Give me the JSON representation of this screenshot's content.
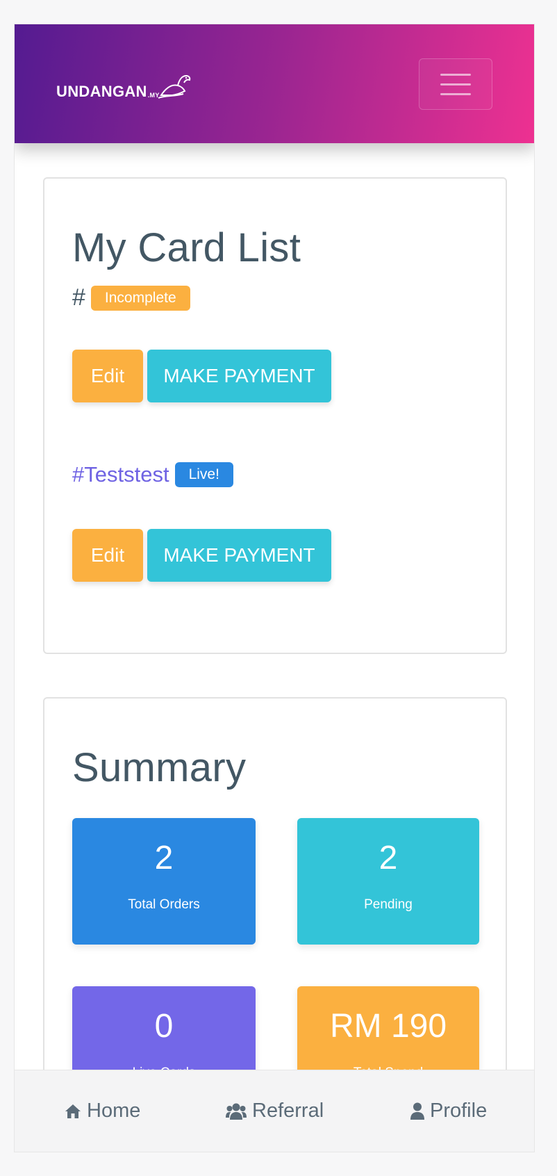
{
  "brand": {
    "name": "UNDANGAN",
    "tld": ".MY"
  },
  "colors": {
    "gradient_start": "#541b91",
    "gradient_end": "#ee3191",
    "warning": "#fbb040",
    "info": "#33c4d8",
    "primary": "#2a88e1",
    "purple": "#7367e8"
  },
  "card_list": {
    "title": "My Card List",
    "entries": [
      {
        "hash": "#",
        "badge": "Incomplete",
        "edit_label": "Edit",
        "pay_label": "MAKE PAYMENT"
      },
      {
        "hash": "#Teststest",
        "badge": "Live!",
        "edit_label": "Edit",
        "pay_label": "MAKE PAYMENT"
      }
    ]
  },
  "summary": {
    "title": "Summary",
    "tiles": [
      {
        "value": "2",
        "label": "Total Orders"
      },
      {
        "value": "2",
        "label": "Pending"
      },
      {
        "value": "0",
        "label": "Live Cards"
      },
      {
        "value": "RM 190",
        "label": "Total Spend"
      }
    ]
  },
  "bottom_nav": [
    {
      "label": "Home",
      "icon": "home-icon"
    },
    {
      "label": "Referral",
      "icon": "users-icon"
    },
    {
      "label": "Profile",
      "icon": "user-icon"
    }
  ]
}
